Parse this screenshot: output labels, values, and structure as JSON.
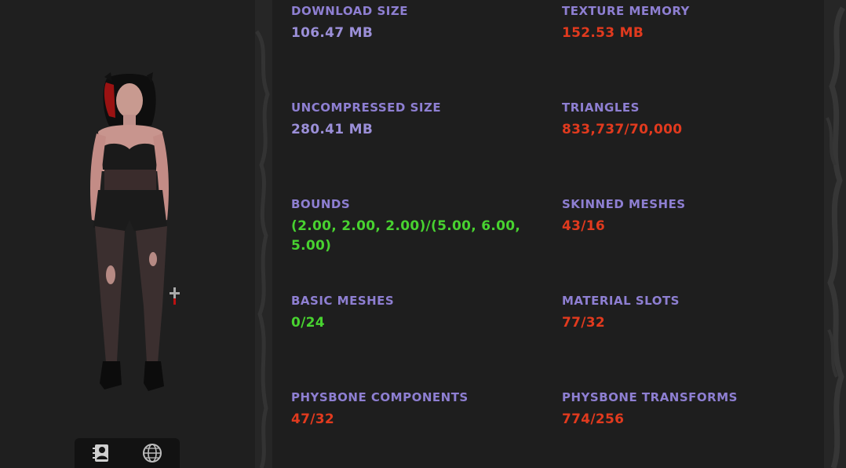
{
  "avatar": {
    "toolbar": {
      "info_icon": "avatar-info-icon",
      "globe_icon": "globe-icon"
    }
  },
  "stats": {
    "download_size": {
      "label": "DOWNLOAD SIZE",
      "value": "106.47 MB",
      "status_color": "#9b8fd8"
    },
    "texture_memory": {
      "label": "TEXTURE MEMORY",
      "value": "152.53 MB",
      "status_color": "#e13a1e"
    },
    "uncompressed_size": {
      "label": "UNCOMPRESSED SIZE",
      "value": "280.41 MB",
      "status_color": "#9b8fd8"
    },
    "triangles": {
      "label": "TRIANGLES",
      "value": "833,737/70,000",
      "status_color": "#e13a1e"
    },
    "bounds": {
      "label": "BOUNDS",
      "value": "(2.00, 2.00, 2.00)/(5.00, 6.00, 5.00)",
      "status_color": "#48d230"
    },
    "skinned_meshes": {
      "label": "SKINNED MESHES",
      "value": "43/16",
      "status_color": "#e13a1e"
    },
    "basic_meshes": {
      "label": "BASIC MESHES",
      "value": "0/24",
      "status_color": "#48d230"
    },
    "material_slots": {
      "label": "MATERIAL SLOTS",
      "value": "77/32",
      "status_color": "#e13a1e"
    },
    "physbone_components": {
      "label": "PHYSBONE COMPONENTS",
      "value": "47/32",
      "status_color": "#e13a1e"
    },
    "physbone_transforms": {
      "label": "PHYSBONE TRANSFORMS",
      "value": "774/256",
      "status_color": "#e13a1e"
    }
  },
  "colors": {
    "label": "#8e7fd2",
    "neutral": "#9b8fd8",
    "bad": "#e13a1e",
    "good": "#48d230"
  }
}
